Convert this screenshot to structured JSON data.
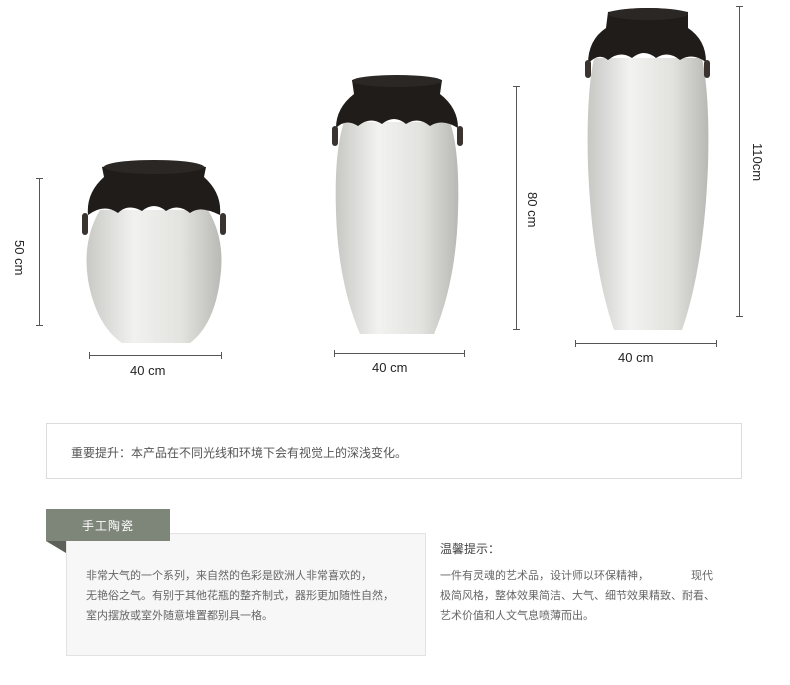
{
  "vases": [
    {
      "height_label": "50 cm",
      "width_label": "40 cm"
    },
    {
      "height_label": "80 cm",
      "width_label": "40 cm"
    },
    {
      "height_label": "110cm",
      "width_label": "40  cm"
    }
  ],
  "notice": {
    "text": "重要提升：本产品在不同光线和环境下会有视觉上的深浅变化。"
  },
  "card": {
    "tag": "手工陶瓷",
    "lines": [
      "非常大气的一个系列，来自然的色彩是欧洲人非常喜欢的，",
      "无艳俗之气。有别于其他花瓶的整齐制式，器形更加随性自然，",
      "室内摆放或室外随意堆置都别具一格。"
    ]
  },
  "tips": {
    "title": "温馨提示：",
    "lines": [
      "一件有灵魂的艺术品，设计师以环保精神，            现代",
      "极简风格，整体效果简洁、大气、细节效果精致、耐看、",
      "艺术价值和人文气息喷薄而出。"
    ]
  },
  "colors": {
    "vase_body": "#e9e9e7",
    "vase_top": "#1f1c1a",
    "line": "#555555",
    "tag_bg": "#7e8579"
  }
}
